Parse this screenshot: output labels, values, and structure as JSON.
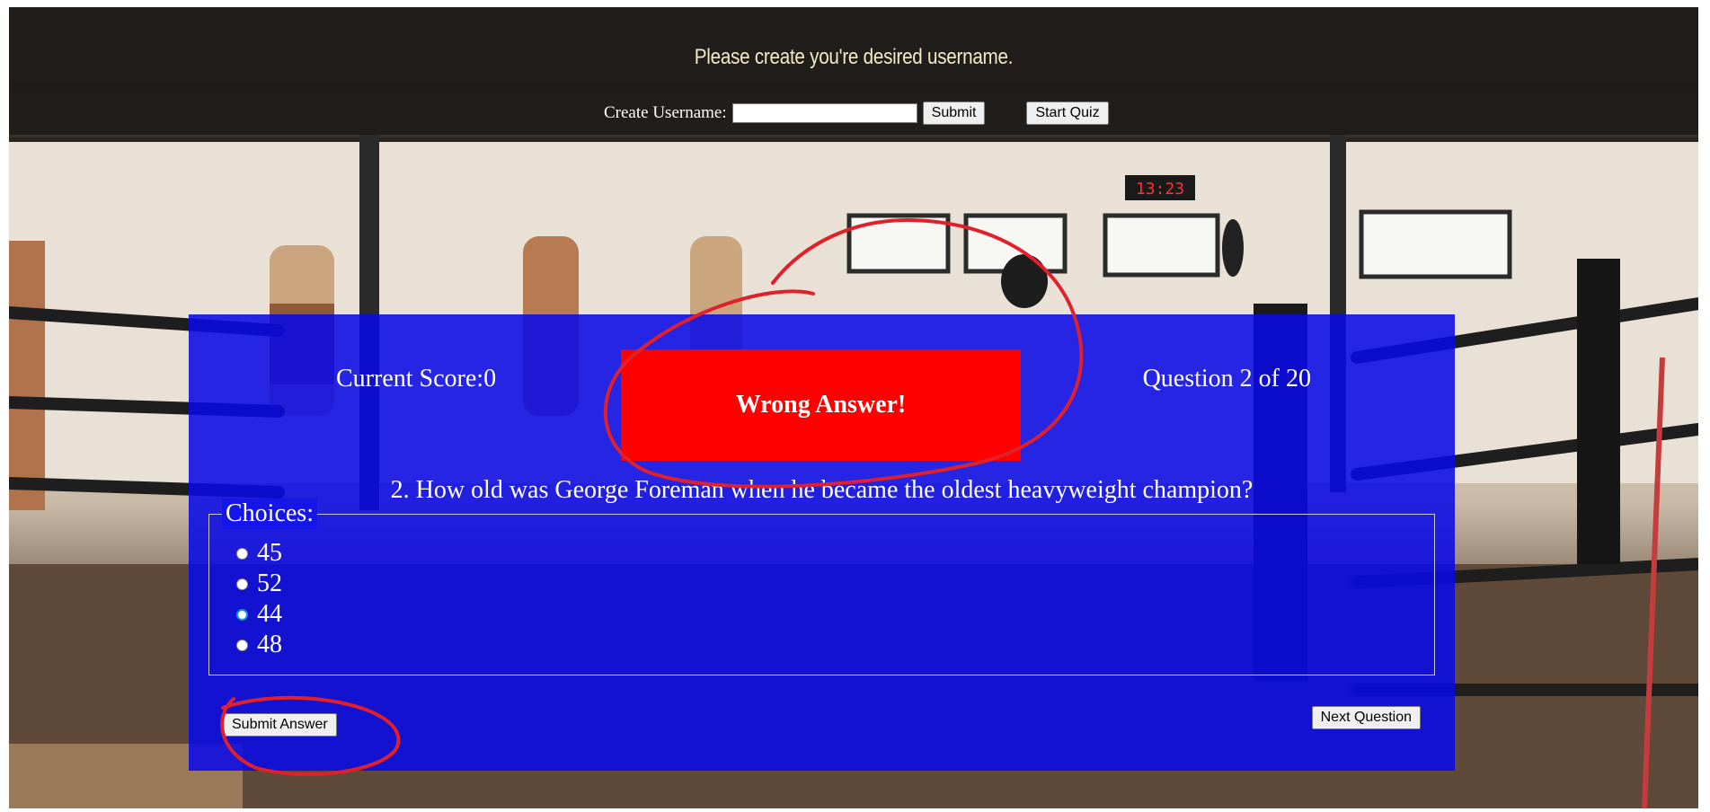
{
  "header": {
    "title": "Please create you're desired username.",
    "username_label": "Create Username:",
    "username_value": "",
    "submit_label": "Submit",
    "start_quiz_label": "Start Quiz"
  },
  "background": {
    "clock_text": "13:23"
  },
  "quiz": {
    "score_text": "Current Score:0",
    "question_counter": "Question 2 of 20",
    "feedback": "Wrong Answer!",
    "feedback_color": "#ff0000",
    "question": "2. How old was George Foreman when he became the oldest heavyweight champion?",
    "choices_legend": "Choices:",
    "choices": [
      {
        "label": "45",
        "checked": false
      },
      {
        "label": "52",
        "checked": false
      },
      {
        "label": "44",
        "checked": true
      },
      {
        "label": "48",
        "checked": false
      }
    ],
    "submit_answer_label": "Submit Answer",
    "next_question_label": "Next Question",
    "panel_color": "#0a0ae6",
    "annotation_color": "#e0202a"
  }
}
